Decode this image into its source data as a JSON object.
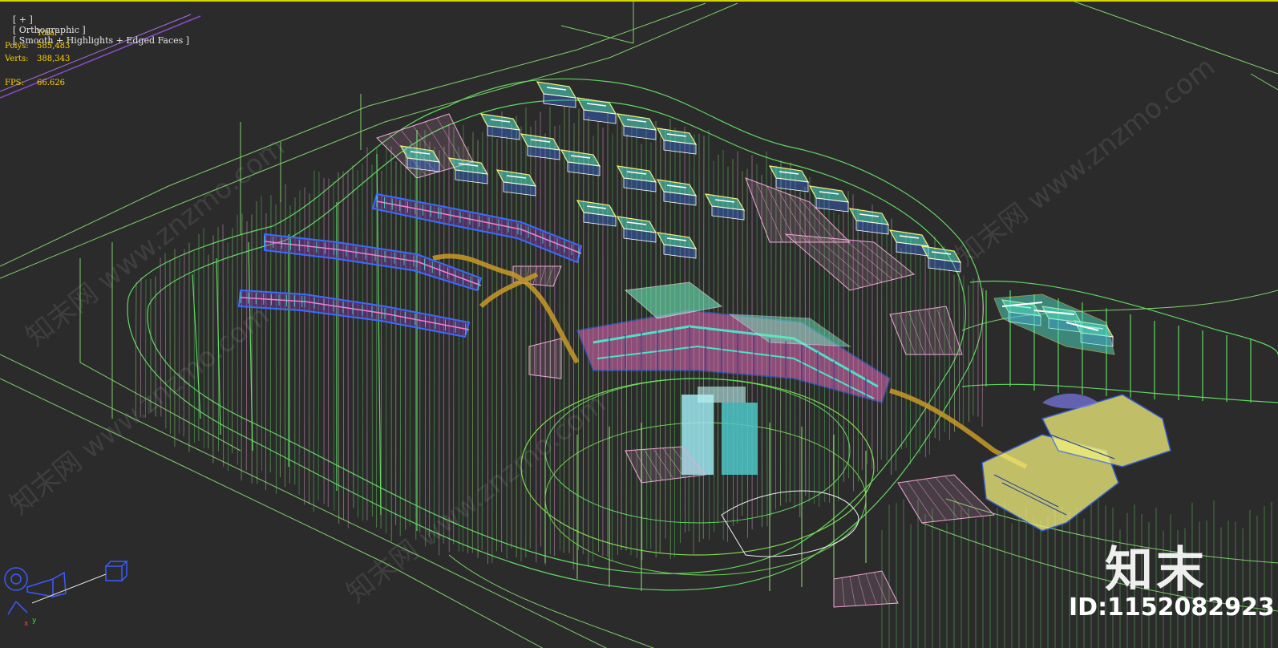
{
  "viewport": {
    "label_parts": [
      "[ + ]",
      "[ Orthographic ]",
      "[ Smooth + Highlights + Edged Faces ]"
    ],
    "stats": {
      "total_label": "Total",
      "polys_label": "Polys:",
      "polys_value": "585,483",
      "verts_label": "Verts:",
      "verts_value": "388,343",
      "fps_label": "FPS:",
      "fps_value": "66.626"
    }
  },
  "watermark": {
    "logo": "知末",
    "id_text": "ID:1152082923",
    "site": "知末网 www.znzmo.com"
  },
  "colors": {
    "background": "#2b2b2b",
    "active_border": "#d8d400",
    "stats_text": "#ffd200",
    "terrain_wire": "#6fe36f",
    "road_wire": "#9bd87a",
    "pink_mesh": "#f0a8d8",
    "building_cyan": "#4fe0c8",
    "building_blue": "#3a6cff",
    "building_purple": "#8a3cd0",
    "path_orange": "#c89a28",
    "building_yellow": "#f2f07a"
  }
}
